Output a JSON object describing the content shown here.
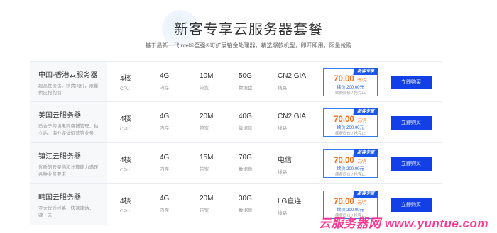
{
  "header": {
    "title": "新客专享云服务器套餐",
    "subtitle": "基于最新一代Intel®至强®可扩展铂金处理器，精选爆款机型，即开即用，限量抢购"
  },
  "plans": [
    {
      "name": "中国-香港云服务器",
      "desc": "超高性价比，续费同价，限量供应抢购到",
      "cpu": "4核",
      "cpu_label": "CPU",
      "ram": "4G",
      "ram_label": "内存",
      "bandwidth": "10M",
      "bandwidth_label": "带宽",
      "disk": "50G",
      "disk_label": "数据盘",
      "line": "CN2 GIA",
      "line_label": "线路",
      "badge": "新客专享",
      "price": "70.00",
      "unit": "元/月",
      "renew": "续价 200.00元",
      "note": "续费同价 / 抢完止",
      "button": "立即购买"
    },
    {
      "name": "美国云服务器",
      "desc": "适合于跨境电商店铺管理、独立站、海外媒体运营等业务",
      "cpu": "4核",
      "cpu_label": "CPU",
      "ram": "4G",
      "ram_label": "内存",
      "bandwidth": "20M",
      "bandwidth_label": "带宽",
      "disk": "40G",
      "disk_label": "数据盘",
      "line": "CN2 GIA",
      "line_label": "线路",
      "badge": "新客专享",
      "price": "70.00",
      "unit": "元/月",
      "renew": "续价 200.00元",
      "note": "续费同价 / 抢完止",
      "button": "立即购买"
    },
    {
      "name": "镇江云服务器",
      "desc": "优质的云架构和计算能力满足各种业务要求",
      "cpu": "4核",
      "cpu_label": "CPU",
      "ram": "4G",
      "ram_label": "内存",
      "bandwidth": "15M",
      "bandwidth_label": "带宽",
      "disk": "70G",
      "disk_label": "数据盘",
      "line": "电信",
      "line_label": "线路",
      "badge": "新客专享",
      "price": "70.00",
      "unit": "元/月",
      "renew": "续价 200.00元",
      "note": "续费同价 / 抢完止",
      "button": "立即购买"
    },
    {
      "name": "韩国云服务器",
      "desc": "亚太优质线路，快速建站，一键上云",
      "cpu": "4核",
      "cpu_label": "CPU",
      "ram": "4G",
      "ram_label": "内存",
      "bandwidth": "20M",
      "bandwidth_label": "带宽",
      "disk": "30G",
      "disk_label": "数据盘",
      "line": "LG直连",
      "line_label": "线路",
      "badge": "新客专享",
      "price": "70.00",
      "unit": "元/月",
      "renew": "续价 200.00元",
      "note": "续费同价 / 抢完止",
      "button": "立即购买"
    }
  ],
  "watermark": "云服务器网 www.yuntue.com",
  "colors": {
    "accent_blue": "#1340e6",
    "price_orange": "#ff6a13",
    "watermark_pink": "#ff2e8a"
  }
}
